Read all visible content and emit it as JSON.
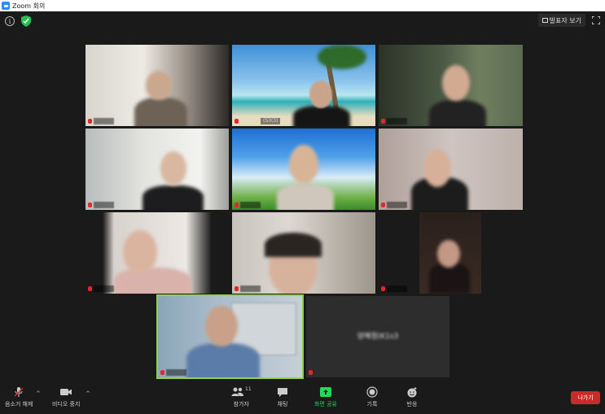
{
  "window": {
    "title": "Zoom 회의"
  },
  "topbar": {
    "speaker_view_label": "발표자 보기"
  },
  "tiles": [
    {
      "name": ""
    },
    {
      "name": "(S3(3)"
    },
    {
      "name": ""
    },
    {
      "name": ""
    },
    {
      "name": ""
    },
    {
      "name": ""
    },
    {
      "name": ""
    },
    {
      "name": ""
    },
    {
      "name": ""
    },
    {
      "name": ""
    },
    {
      "name": "양혜정(K1s3"
    }
  ],
  "toolbar": {
    "mute_label": "음소거 해제",
    "video_label": "비디오 중지",
    "participants_label": "참가자",
    "participants_count": "11",
    "chat_label": "채팅",
    "share_label": "화면 공유",
    "record_label": "기록",
    "reactions_label": "반응",
    "leave_label": "나가기"
  },
  "colors": {
    "share_green": "#23d959",
    "leave_red": "#c92a2a",
    "active_speaker_border": "#8fd14f"
  }
}
